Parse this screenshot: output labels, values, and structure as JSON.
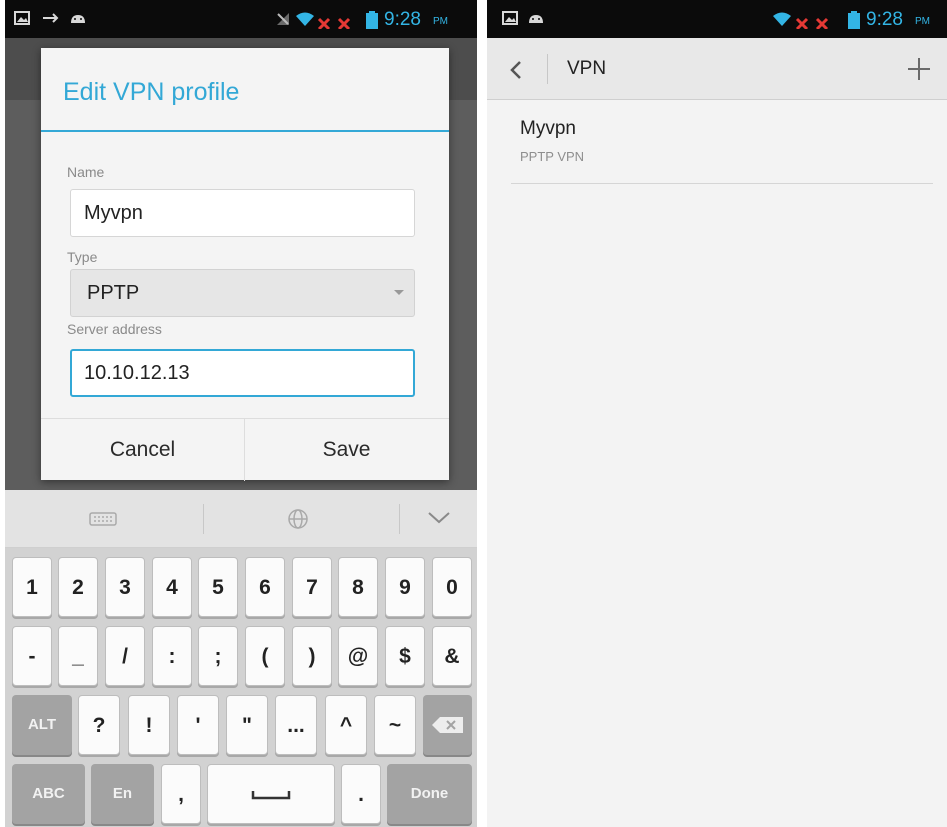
{
  "left_screen": {
    "status_bar": {
      "time": "9:28",
      "ampm": "PM"
    },
    "dialog": {
      "title": "Edit VPN profile",
      "name_label": "Name",
      "name_value": "Myvpn",
      "type_label": "Type",
      "type_value": "PPTP",
      "server_label": "Server address",
      "server_value": "10.10.12.13",
      "cancel_label": "Cancel",
      "save_label": "Save"
    },
    "keyboard": {
      "row1": [
        "1",
        "2",
        "3",
        "4",
        "5",
        "6",
        "7",
        "8",
        "9",
        "0"
      ],
      "row2": [
        "-",
        "_",
        "/",
        ":",
        ";",
        "(",
        ")",
        "@",
        "$",
        "&"
      ],
      "row3": [
        "ALT",
        "?",
        "!",
        "'",
        "\"",
        "...",
        "^",
        "~"
      ],
      "row4": [
        "ABC",
        "En",
        ",",
        ".",
        "Done"
      ]
    }
  },
  "right_screen": {
    "status_bar": {
      "time": "9:28",
      "ampm": "PM"
    },
    "action_bar": {
      "title": "VPN"
    },
    "vpn_list": [
      {
        "name": "Myvpn",
        "type": "PPTP VPN"
      }
    ]
  },
  "colors": {
    "accent": "#33a8d6",
    "status_icon": "#33b5e5",
    "status_bar_bg": "#0b0b0b",
    "dialog_bg": "#f4f4f4"
  }
}
